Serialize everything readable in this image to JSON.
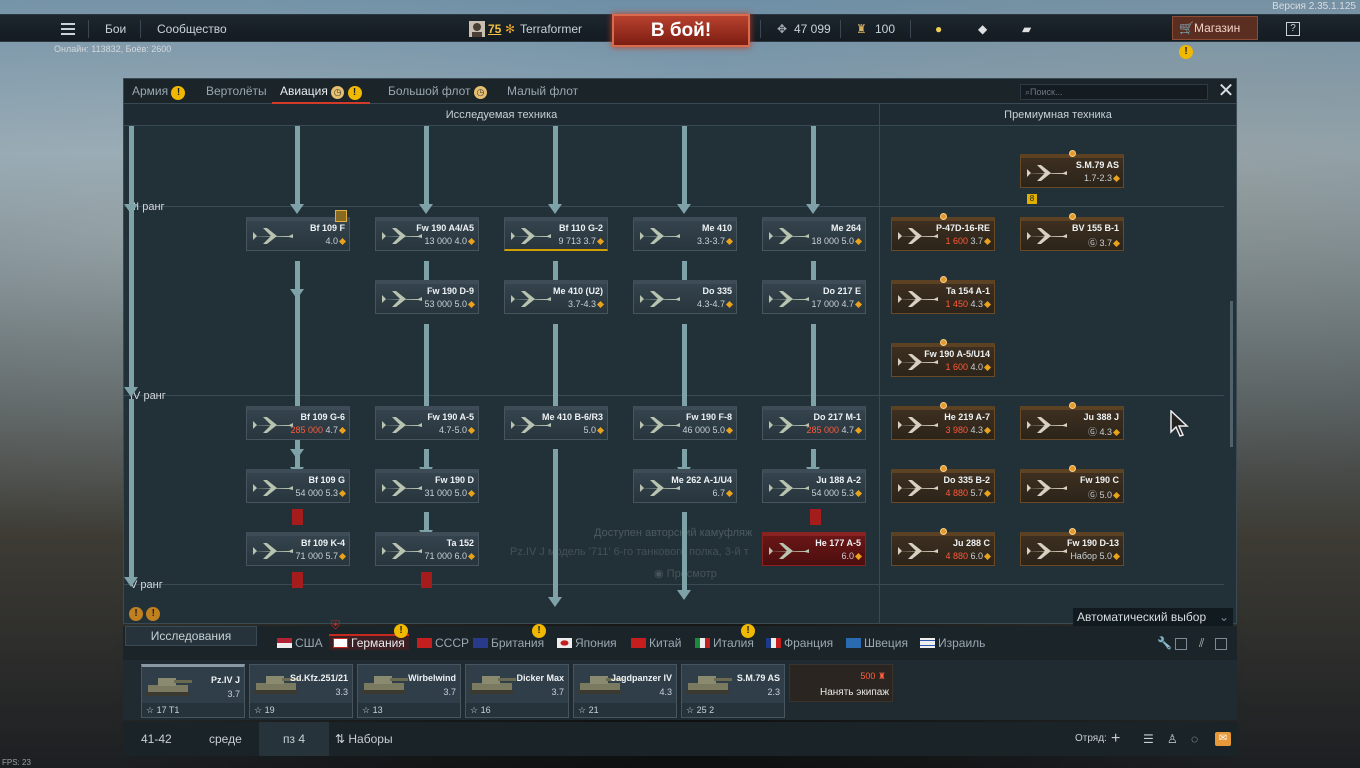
{
  "version": "Версия 2.35.1.125",
  "topbar": {
    "battles": "Бои",
    "community": "Сообщество",
    "player_level": "75",
    "player_name": "Terraformer",
    "battle_button": "В бой!",
    "silver": "47 099",
    "gold": "100",
    "shop": "Магазин",
    "help": "?"
  },
  "online": "Онлайн: 113832, Боёв: 2600",
  "tabs": [
    "Армия",
    "Вертолёты",
    "Авиация",
    "Большой флот",
    "Малый флот"
  ],
  "search_placeholder": "Поиск...",
  "columns": {
    "researched": "Исследуемая техника",
    "premium": "Премиумная техника"
  },
  "ranks": [
    "III ранг",
    "IV ранг",
    "V ранг"
  ],
  "cards": [
    {
      "name": "S.M.79 AS",
      "info": "1.7-2.3",
      "type": "prem",
      "badge": "8"
    },
    {
      "name": "Bf 109 F",
      "info": "4.0",
      "type": "std"
    },
    {
      "name": "Fw 190 A4/A5",
      "rp": "13 000",
      "info": "4.0",
      "type": "std"
    },
    {
      "name": "Bf 110 G-2",
      "rp": "9 713",
      "info": "3.7",
      "type": "std",
      "hl": true
    },
    {
      "name": "Me 410",
      "info": "3.3-3.7",
      "type": "std"
    },
    {
      "name": "Me 264",
      "rp": "18 000",
      "info": "5.0",
      "type": "std"
    },
    {
      "name": "P-47D-16-RE",
      "rp": "1 600",
      "info": "3.7",
      "type": "prem"
    },
    {
      "name": "BV 155 B-1",
      "rp": "Ⓖ",
      "info": "3.7",
      "type": "prem"
    },
    {
      "name": "Fw 190 D-9",
      "rp": "53 000",
      "info": "5.0",
      "type": "std"
    },
    {
      "name": "Me 410 (U2)",
      "info": "3.7-4.3",
      "type": "std"
    },
    {
      "name": "Do 335",
      "info": "4.3-4.7",
      "type": "std"
    },
    {
      "name": "Do 217 E",
      "rp": "17 000",
      "info": "4.7",
      "type": "std"
    },
    {
      "name": "Ta 154 A-1",
      "rp": "1 450",
      "info": "4.3",
      "type": "prem"
    },
    {
      "name": "Fw 190 A-5/U14",
      "rp": "1 600",
      "info": "4.0",
      "type": "prem"
    },
    {
      "name": "Bf 109 G-6",
      "rp": "285 000",
      "info": "4.7",
      "type": "std"
    },
    {
      "name": "Fw 190 A-5",
      "info": "4.7-5.0",
      "type": "std"
    },
    {
      "name": "Me 410 B-6/R3",
      "info": "5.0",
      "type": "std"
    },
    {
      "name": "Fw 190 F-8",
      "rp": "46 000",
      "info": "5.0",
      "type": "std"
    },
    {
      "name": "Do 217 M-1",
      "rp": "285 000",
      "info": "4.7",
      "type": "std"
    },
    {
      "name": "He 219 A-7",
      "rp": "3 980",
      "info": "4.3",
      "type": "prem"
    },
    {
      "name": "Ju 388 J",
      "rp": "Ⓖ",
      "info": "4.3",
      "type": "prem"
    },
    {
      "name": "Bf 109 G",
      "rp": "54 000",
      "info": "5.3",
      "type": "std"
    },
    {
      "name": "Fw 190 D",
      "rp": "31 000",
      "info": "5.0",
      "type": "std"
    },
    {
      "name": "Me 262 A-1/U4",
      "info": "6.7",
      "type": "std"
    },
    {
      "name": "Ju 188 A-2",
      "rp": "54 000",
      "info": "5.3",
      "type": "std"
    },
    {
      "name": "Do 335 B-2",
      "rp": "4 880",
      "info": "5.7",
      "type": "prem"
    },
    {
      "name": "Fw 190 C",
      "rp": "Ⓖ",
      "info": "5.0",
      "type": "prem"
    },
    {
      "name": "Bf 109 K-4",
      "rp": "71 000",
      "info": "5.7",
      "type": "std"
    },
    {
      "name": "Ta 152",
      "rp": "71 000",
      "info": "6.0",
      "type": "std"
    },
    {
      "name": "He 177 A-5",
      "info": "6.0",
      "type": "red"
    },
    {
      "name": "Ju 288 C",
      "rp": "4 880",
      "info": "6.0",
      "type": "prem"
    },
    {
      "name": "Fw 190 D-13",
      "rp": "Набор",
      "info": "5.0",
      "type": "prem"
    }
  ],
  "ghost_notice": {
    "title": "Доступен авторский камуфляж",
    "body": "Pz.IV J модель '711' 6-го танкового полка, 3-й т",
    "view": "Просмотр"
  },
  "auto_select": "Автоматический выбор",
  "research_button": "Исследования",
  "nations": [
    "США",
    "Германия",
    "СССР",
    "Британия",
    "Япония",
    "Китай",
    "Италия",
    "Франция",
    "Швеция",
    "Израиль"
  ],
  "crew": [
    {
      "name": "Pz.IV J",
      "br": "3.7",
      "num": "17",
      "extra": "T1"
    },
    {
      "name": "Sd.Kfz.251/21",
      "br": "3.3",
      "num": "19"
    },
    {
      "name": "Wirbelwind",
      "br": "3.7",
      "num": "13"
    },
    {
      "name": "Dicker Max",
      "br": "3.7",
      "num": "16"
    },
    {
      "name": "Jagdpanzer IV",
      "br": "4.3",
      "num": "21"
    },
    {
      "name": "S.M.79 AS",
      "br": "2.3",
      "num": "25",
      "extra": "2"
    }
  ],
  "hire": {
    "label": "Нанять экипаж",
    "cost": "500"
  },
  "footer": {
    "b1": "41-42",
    "b2": "среде",
    "b3": "пз 4",
    "b4": "Наборы",
    "squad": "Отряд:"
  },
  "fps": "FPS: 23",
  "colors": {
    "accent": "#d23a2a",
    "battle": "#b8412e",
    "bar": "#7fa2a8",
    "premium": "#3d2f20"
  }
}
